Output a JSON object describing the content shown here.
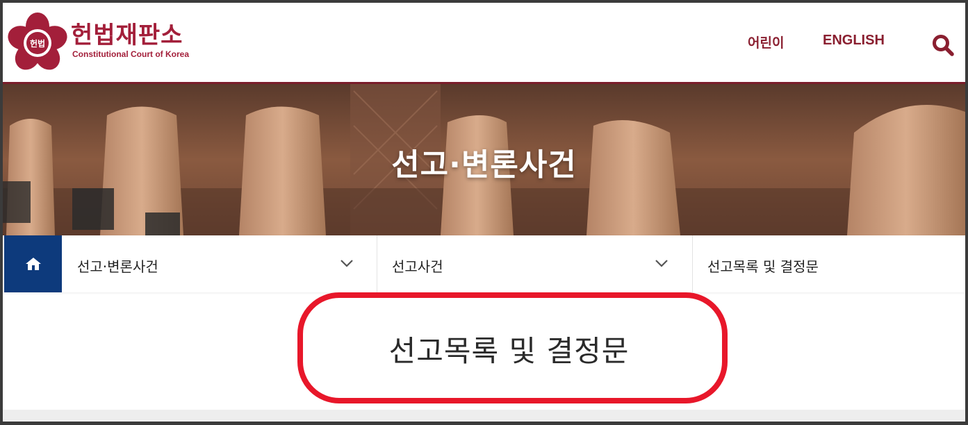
{
  "header": {
    "logo_emblem_text": "헌법",
    "logo_title": "헌법재판소",
    "logo_subtitle": "Constitutional Court of Korea",
    "nav": {
      "kids": "어린이",
      "english": "ENGLISH"
    },
    "search_icon": "search-icon"
  },
  "banner": {
    "title": "선고·변론사건"
  },
  "location_bar": {
    "home_icon": "home-icon",
    "level1": "선고·변론사건",
    "level2": "선고사건",
    "level3": "선고목록 및 결정문"
  },
  "page": {
    "title": "선고목록 및 결정문"
  },
  "colors": {
    "brand": "#a31f3a",
    "home_bg": "#0d3a7c",
    "highlight": "#e8172a"
  }
}
